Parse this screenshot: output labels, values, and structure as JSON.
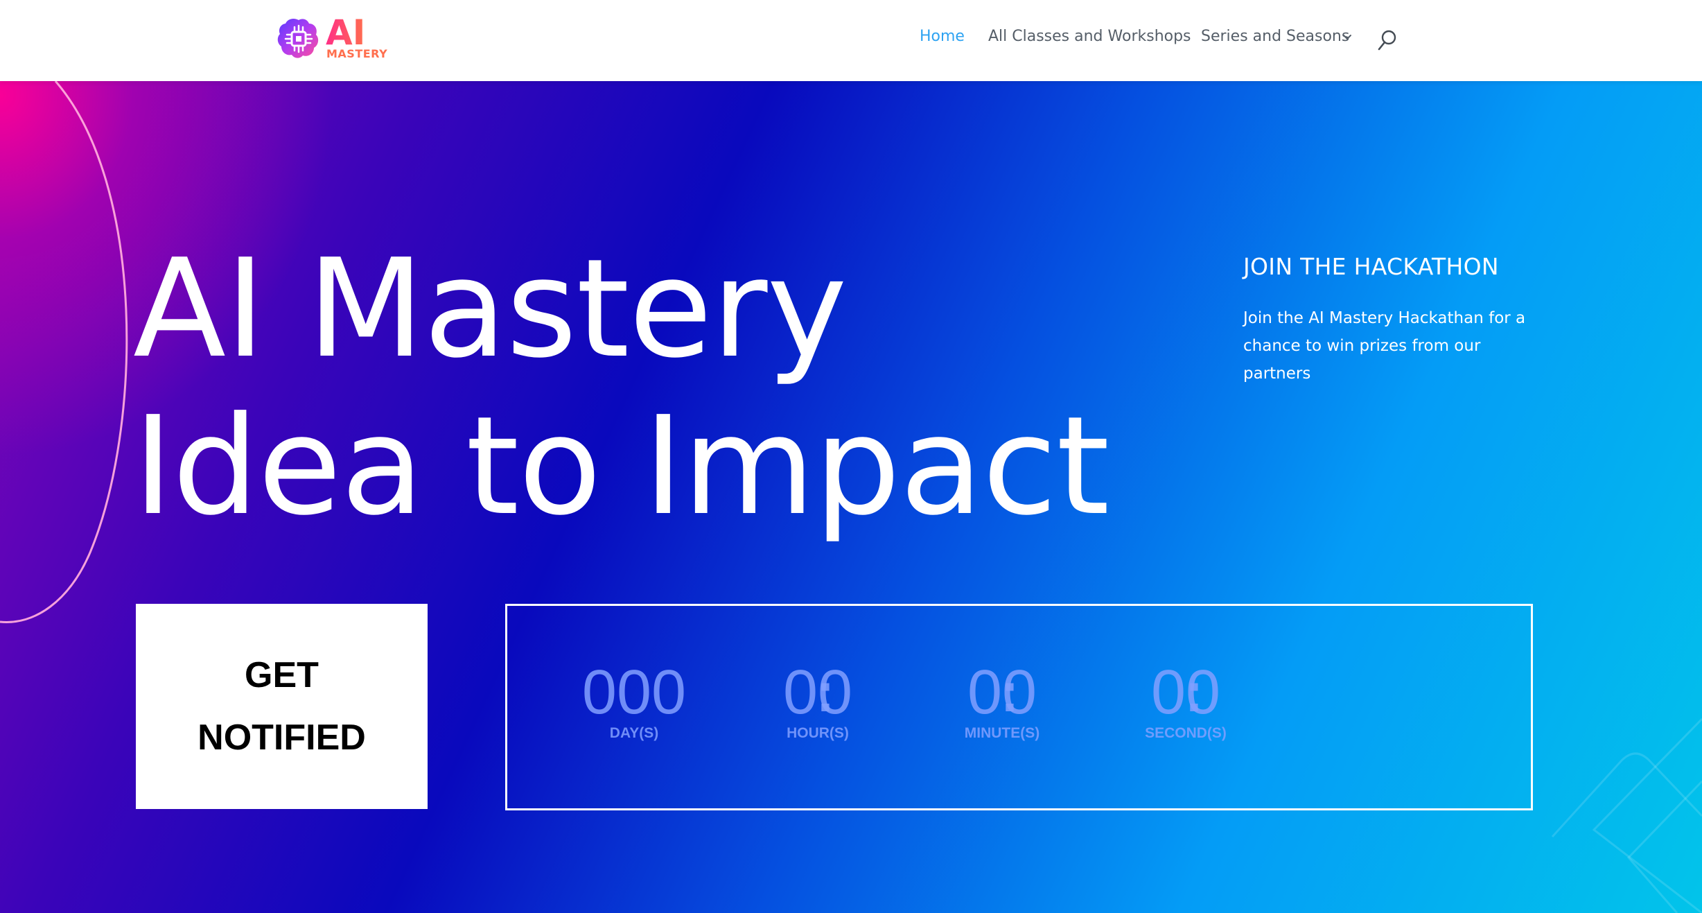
{
  "logo": {
    "primary": "AI",
    "secondary": "MASTERY",
    "icon": "brain-chip-icon"
  },
  "nav": {
    "items": [
      {
        "label": "Home",
        "active": true
      },
      {
        "label": "All Classes and Workshops",
        "active": false
      },
      {
        "label": "Series and Seasons",
        "active": false,
        "has_dropdown": true
      }
    ],
    "search_icon": "search-icon"
  },
  "hero": {
    "title_line1": "AI Mastery",
    "title_line2": "Idea to Impact",
    "join_heading": "JOIN THE HACKATHON",
    "join_text": "Join the AI Mastery Hackathan for a chance to win prizes from our partners",
    "cta_line1": "GET",
    "cta_line2": "NOTIFIED"
  },
  "countdown": {
    "units": [
      {
        "value": "000",
        "label": "DAY(S)"
      },
      {
        "value": "00",
        "label": "HOUR(S)"
      },
      {
        "value": "00",
        "label": "MINUTE(S)"
      },
      {
        "value": "00",
        "label": "SECOND(S)"
      }
    ],
    "separator": ":"
  },
  "colors": {
    "nav_active": "#2ea3f2",
    "nav_text": "#555e68",
    "logo_gradient_start": "#ff2f86",
    "logo_gradient_end": "#ff6f4e",
    "hero_pink": "#ff0096",
    "hero_blue": "#0909bd",
    "hero_cyan": "#02c4ea",
    "countdown_text": "#82a0ff"
  }
}
